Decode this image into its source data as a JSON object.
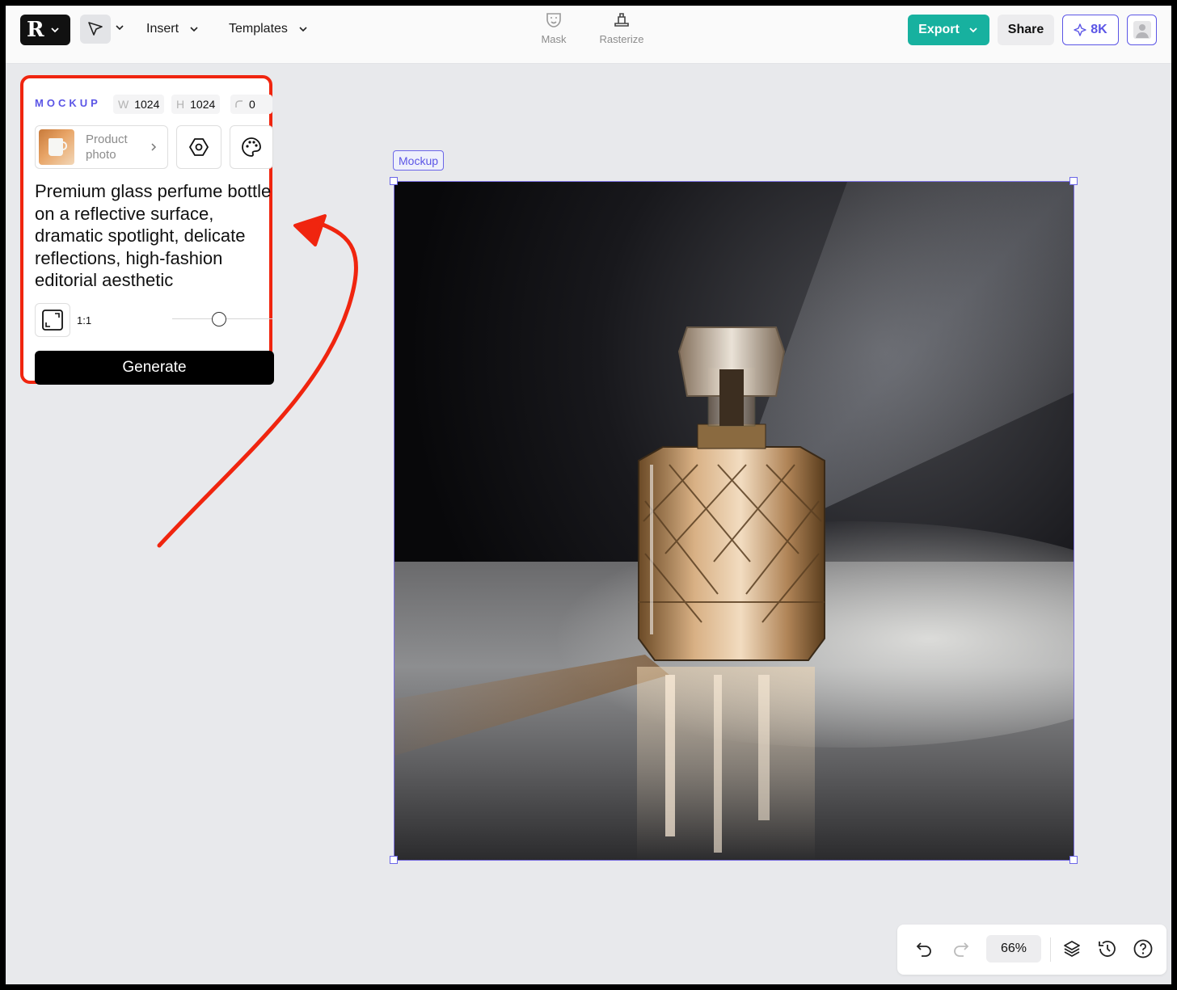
{
  "header": {
    "menus": [
      {
        "label": "Insert"
      },
      {
        "label": "Templates"
      }
    ],
    "center_tools": [
      {
        "label": "Mask",
        "icon": "mask-icon"
      },
      {
        "label": "Rasterize",
        "icon": "rasterize-icon"
      }
    ],
    "export_label": "Export",
    "share_label": "Share",
    "credits_label": "8K"
  },
  "panel": {
    "title": "MOCKUP",
    "width": {
      "label": "W",
      "value": "1024"
    },
    "height": {
      "label": "H",
      "value": "1024"
    },
    "radius": {
      "value": "0"
    },
    "product_label": "Product photo",
    "prompt": "Premium glass perfume bottle on a reflective surface, dramatic spotlight, delicate reflections, high-fashion editorial aesthetic",
    "ratio_label": "1:1",
    "generate_label": "Generate"
  },
  "canvas": {
    "tag_label": "Mockup",
    "image_subject": "perfume bottle under spotlight"
  },
  "bottom_bar": {
    "zoom_label": "66%"
  },
  "colors": {
    "accent": "#5b55e6",
    "export_bg": "#17b19f",
    "annotation": "#f0250f"
  }
}
